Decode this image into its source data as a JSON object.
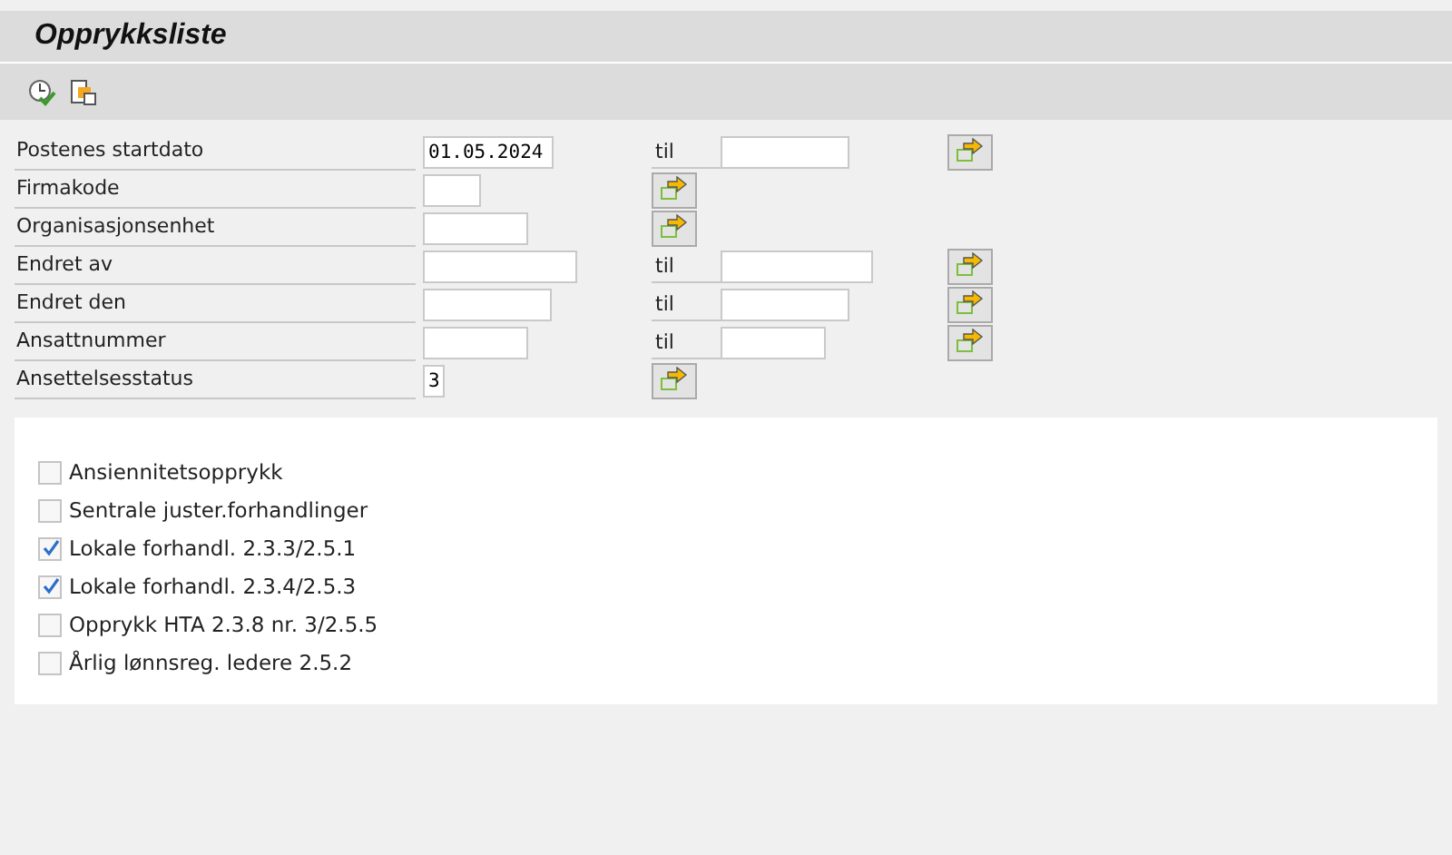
{
  "window": {
    "title": "Opprykksliste"
  },
  "toolbar": [
    {
      "kind": "execute"
    },
    {
      "kind": "variants"
    }
  ],
  "fields": [
    {
      "kind": "range",
      "label": "Postenes startdato",
      "value": "01.05.2024",
      "til": "til"
    },
    {
      "kind": "single",
      "label": "Firmakode"
    },
    {
      "kind": "single",
      "label": "Organisasjonsenhet"
    },
    {
      "kind": "range",
      "label": "Endret av",
      "til": "til"
    },
    {
      "kind": "range",
      "label": "Endret den",
      "til": "til"
    },
    {
      "kind": "range",
      "label": "Ansattnummer",
      "til": "til"
    },
    {
      "kind": "single",
      "label": "Ansettelsesstatus",
      "value": "3"
    }
  ],
  "options": [
    {
      "label": "Ansiennitetsopprykk",
      "checked": false
    },
    {
      "label": "Sentrale juster.forhandlinger",
      "checked": false
    },
    {
      "label": "Lokale forhandl. 2.3.3/2.5.1",
      "checked": true
    },
    {
      "label": "Lokale forhandl. 2.3.4/2.5.3",
      "checked": true
    },
    {
      "label": "Opprykk HTA 2.3.8 nr. 3/2.5.5",
      "checked": false
    },
    {
      "label": "Årlig lønnsreg. ledere 2.5.2",
      "checked": false
    }
  ]
}
